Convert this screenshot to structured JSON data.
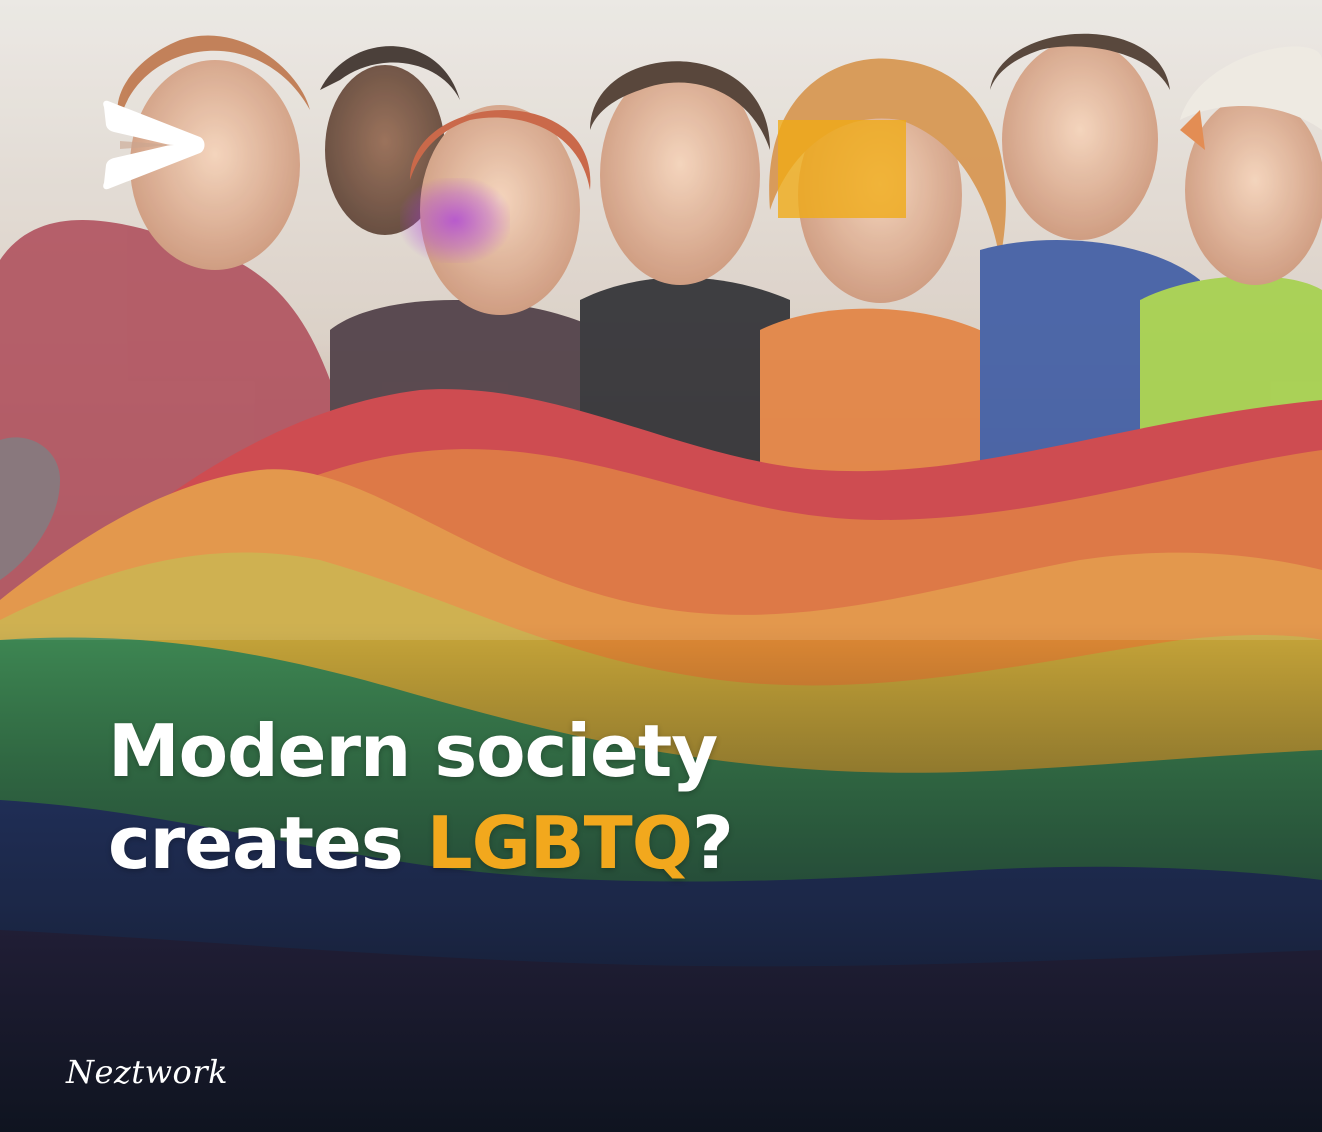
{
  "headline": {
    "line1": "Modern society",
    "line2_prefix": "creates ",
    "line2_highlight": "LGBTQ",
    "line2_suffix": "?"
  },
  "brand": {
    "name": "Neztwork"
  },
  "icons": {
    "logo": "play-chevron-logo-icon"
  },
  "colors": {
    "accent": "#f2a81d",
    "text": "#ffffff",
    "dark_footer": "#0f1420",
    "flag_stripes": [
      "#c8343a",
      "#e07a35",
      "#e6b43a",
      "#3f8a55",
      "#2b3f78",
      "#4a2c63"
    ]
  }
}
